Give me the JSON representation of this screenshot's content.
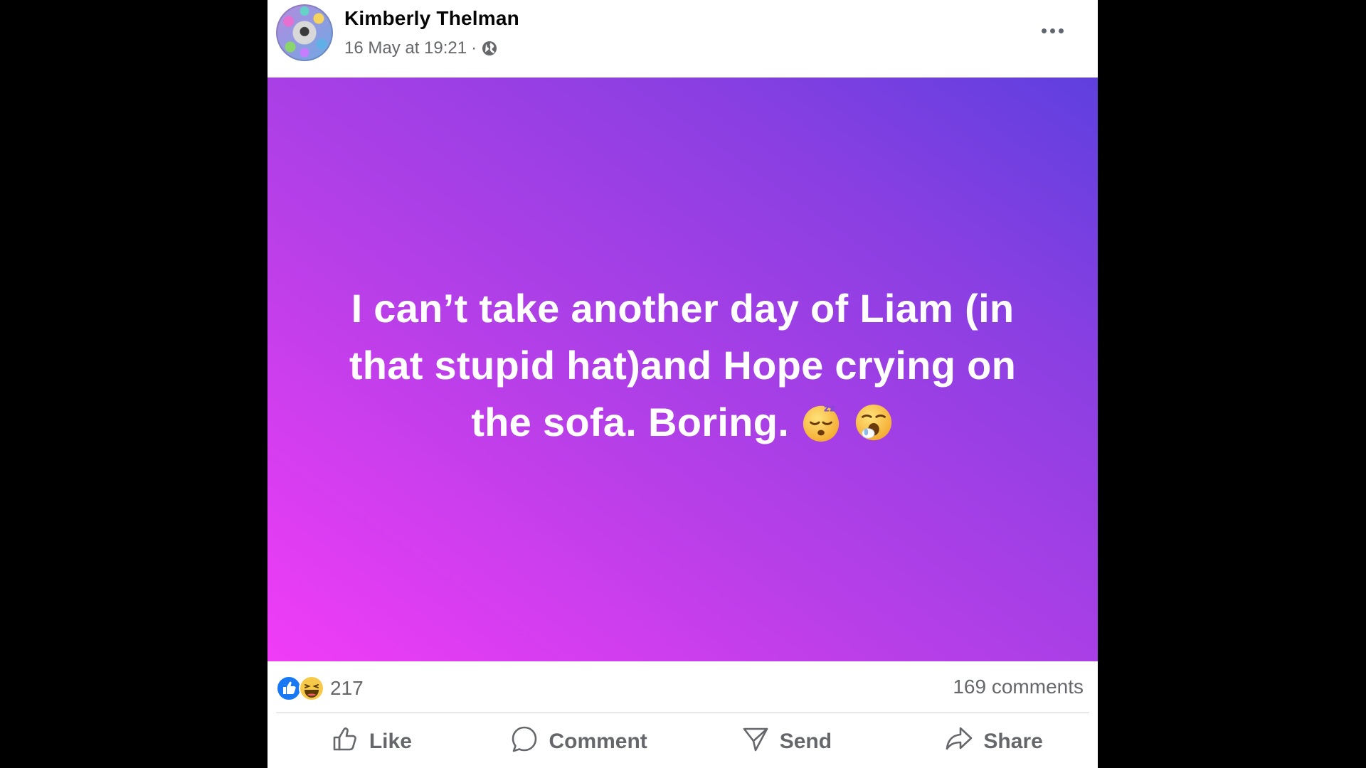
{
  "post": {
    "author": "Kimberly Thelman",
    "timestamp": "16 May at 19:21",
    "separator": "·",
    "privacy_icon": "globe-icon",
    "menu_icon": "more-horizontal-icon",
    "text": "I can’t take another day of Liam (in that stupid hat)and Hope crying on the sofa. Boring.",
    "emojis": [
      "sleeping-face-emoji",
      "yawning-face-emoji"
    ],
    "background_gradient": [
      "#f13cf7",
      "#5f3fdf"
    ]
  },
  "stats": {
    "reaction_icons": [
      "like-reaction-icon",
      "haha-reaction-icon"
    ],
    "reaction_count": "217",
    "comments": "169 comments"
  },
  "actions": {
    "like": "Like",
    "comment": "Comment",
    "send": "Send",
    "share": "Share"
  },
  "colors": {
    "text_secondary": "#65676b",
    "like_blue": "#1877f2",
    "haha_yellow": "#f7c94b"
  }
}
